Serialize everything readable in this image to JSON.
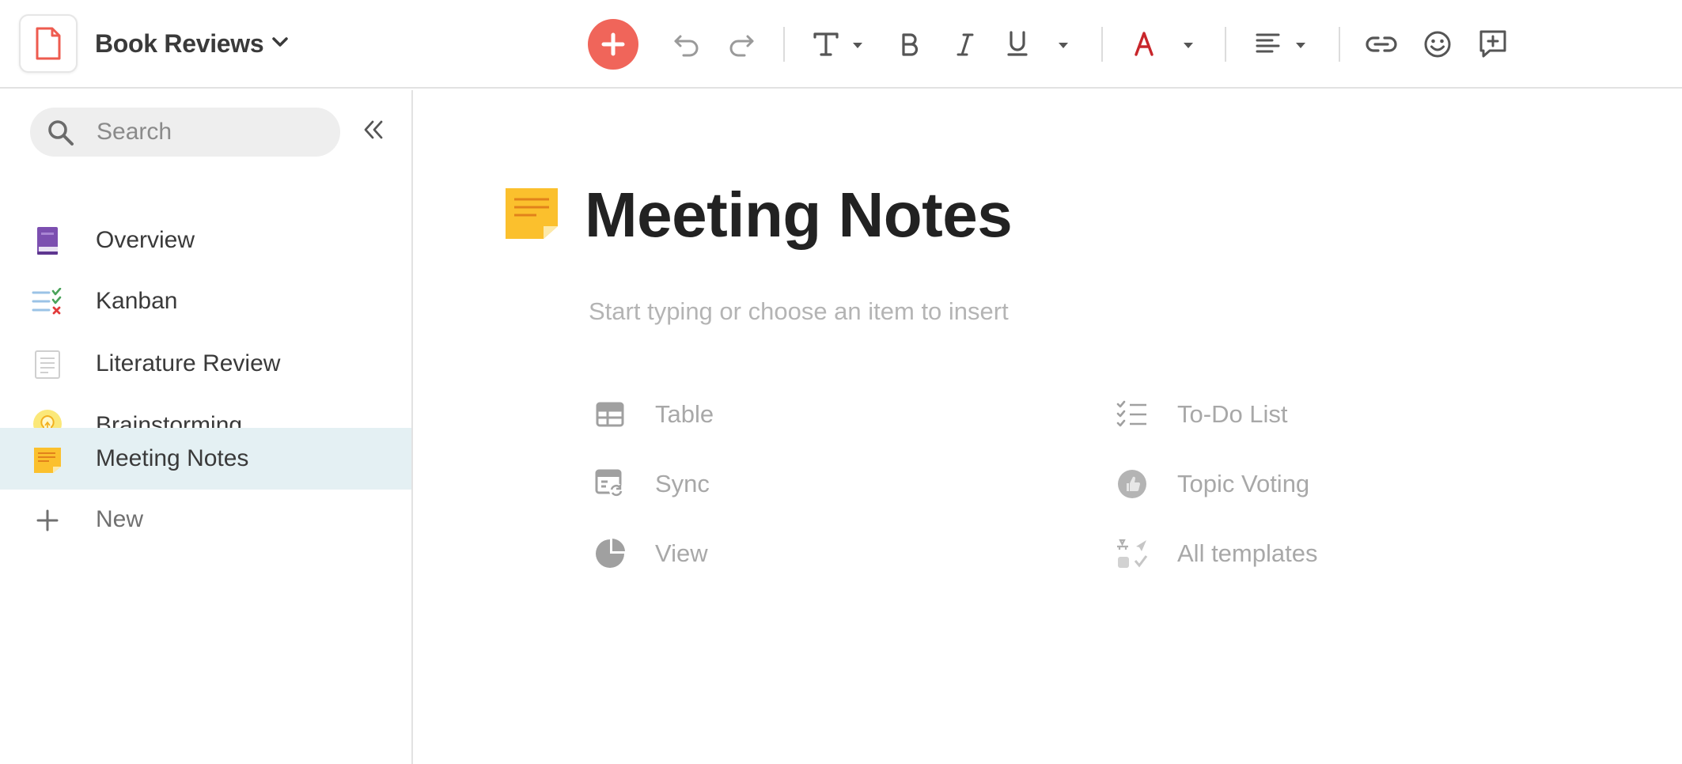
{
  "header": {
    "workspace_name": "Book Reviews",
    "toolbar": [
      {
        "name": "add-block-button",
        "icon": "plus-icon"
      },
      {
        "name": "undo-button",
        "icon": "undo-icon"
      },
      {
        "name": "redo-button",
        "icon": "redo-icon"
      },
      {
        "name": "text-style-button",
        "icon": "text-style-icon"
      },
      {
        "name": "bold-button",
        "icon": "bold-icon"
      },
      {
        "name": "italic-button",
        "icon": "italic-icon"
      },
      {
        "name": "underline-button",
        "icon": "underline-icon"
      },
      {
        "name": "text-color-button",
        "icon": "text-color-icon"
      },
      {
        "name": "align-button",
        "icon": "align-left-icon"
      },
      {
        "name": "link-button",
        "icon": "link-icon"
      },
      {
        "name": "emoji-button",
        "icon": "emoji-icon"
      },
      {
        "name": "add-comment-button",
        "icon": "comment-plus-icon"
      }
    ],
    "colors": {
      "add": "#f0655a",
      "text_color": "#c8262b"
    }
  },
  "sidebar": {
    "search_placeholder": "Search",
    "items": [
      {
        "label": "Overview",
        "icon": "book-icon",
        "active": false
      },
      {
        "label": "Kanban",
        "icon": "checklist-icon",
        "active": false
      },
      {
        "label": "Literature Review",
        "icon": "document-icon",
        "active": false
      },
      {
        "label": "Brainstorming",
        "icon": "lightbulb-icon",
        "active": false
      },
      {
        "label": "Meeting Notes",
        "icon": "sticky-note-icon",
        "active": true
      },
      {
        "label": "New",
        "icon": "plus-icon",
        "active": false
      }
    ],
    "active_color": "#e4f0f3"
  },
  "main": {
    "title": "Meeting Notes",
    "placeholder": "Start typing or choose an item to insert",
    "insert_items": [
      {
        "label": "Table",
        "icon": "table-icon"
      },
      {
        "label": "Sync",
        "icon": "sync-icon"
      },
      {
        "label": "View",
        "icon": "pie-chart-icon"
      },
      {
        "label": "To-Do List",
        "icon": "todo-list-icon"
      },
      {
        "label": "Topic Voting",
        "icon": "thumbs-up-icon"
      },
      {
        "label": "All templates",
        "icon": "templates-icon"
      }
    ]
  }
}
